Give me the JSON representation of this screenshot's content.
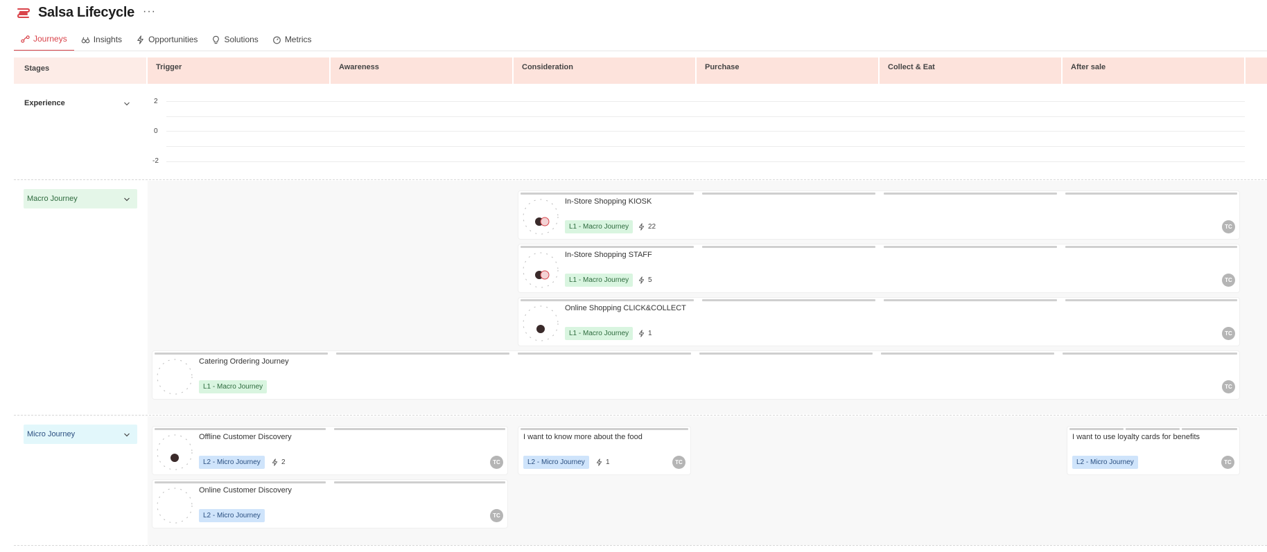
{
  "app": {
    "title": "Salsa Lifecycle",
    "more_label": "···",
    "accent_color": "#d9434a"
  },
  "tabs": [
    {
      "label": "Journeys",
      "icon": "journey-icon",
      "active": true
    },
    {
      "label": "Insights",
      "icon": "binoculars-icon",
      "active": false
    },
    {
      "label": "Opportunities",
      "icon": "lightning-icon",
      "active": false
    },
    {
      "label": "Solutions",
      "icon": "lightbulb-icon",
      "active": false
    },
    {
      "label": "Metrics",
      "icon": "gauge-icon",
      "active": false
    }
  ],
  "stages_label": "Stages",
  "stages": [
    "Trigger",
    "Awareness",
    "Consideration",
    "Purchase",
    "Collect & Eat",
    "After sale"
  ],
  "experience": {
    "label": "Experience",
    "ticks": [
      "2",
      "0",
      "-2"
    ]
  },
  "sections": {
    "macro": {
      "label": "Macro Journey",
      "color": "#e4f6e8"
    },
    "micro": {
      "label": "Micro Journey",
      "color": "#e2f7fb"
    }
  },
  "macro_cards": [
    {
      "title": "In-Store Shopping KIOSK",
      "tag": "L1 - Macro Journey",
      "opportunities": "22",
      "owner": "TC"
    },
    {
      "title": "In-Store Shopping STAFF",
      "tag": "L1 - Macro Journey",
      "opportunities": "5",
      "owner": "TC"
    },
    {
      "title": "Online Shopping CLICK&COLLECT",
      "tag": "L1 - Macro Journey",
      "opportunities": "1",
      "owner": "TC"
    },
    {
      "title": "Catering Ordering Journey",
      "tag": "L1 - Macro Journey",
      "owner": "TC"
    }
  ],
  "micro_cards": [
    {
      "title": "Offline Customer Discovery",
      "tag": "L2 - Micro Journey",
      "opportunities": "2",
      "owner": "TC"
    },
    {
      "title": "I want to know more about the food",
      "tag": "L2 - Micro Journey",
      "opportunities": "1",
      "owner": "TC"
    },
    {
      "title": "I want to use loyalty cards for benefits",
      "tag": "L2 - Micro Journey",
      "owner": "TC"
    },
    {
      "title": "Online Customer Discovery",
      "tag": "L2 - Micro Journey",
      "owner": "TC"
    }
  ]
}
